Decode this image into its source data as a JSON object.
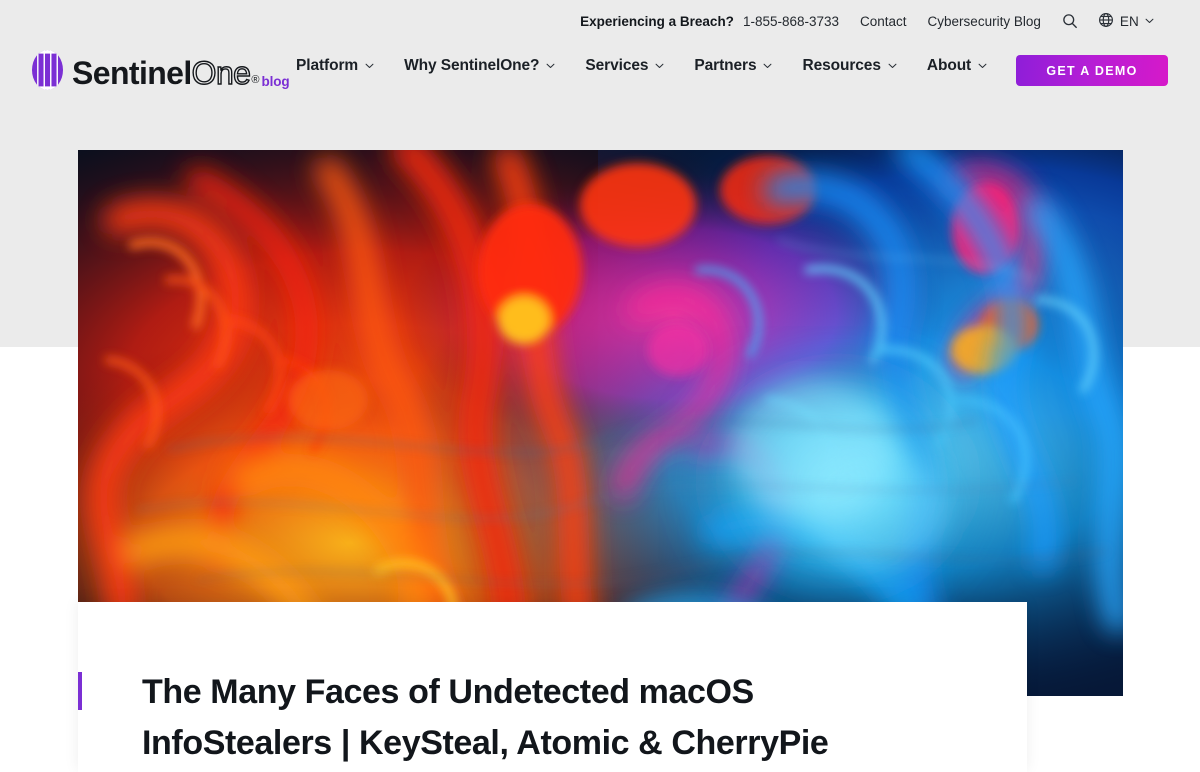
{
  "site": {
    "logo": {
      "mark": "sentinelone-logo-mark",
      "word_bold": "Sentinel",
      "word_outline": "One",
      "registered": "®",
      "sub_brand": "blog"
    },
    "brand_purple": "#7b2fd4",
    "header_background": "#ebebeb"
  },
  "utility_bar": {
    "breach_label": "Experiencing a Breach?",
    "breach_phone": "1-855-868-3733",
    "links": [
      {
        "label": "Contact"
      },
      {
        "label": "Cybersecurity Blog"
      }
    ],
    "search_icon": "search-icon",
    "globe_icon": "globe-icon",
    "language": "EN",
    "language_chevron": "chevron-down-icon"
  },
  "nav": {
    "items": [
      {
        "label": "Platform",
        "has_dropdown": true
      },
      {
        "label": "Why SentinelOne?",
        "has_dropdown": true
      },
      {
        "label": "Services",
        "has_dropdown": true
      },
      {
        "label": "Partners",
        "has_dropdown": true
      },
      {
        "label": "Resources",
        "has_dropdown": true
      },
      {
        "label": "About",
        "has_dropdown": true
      }
    ],
    "cta": {
      "label": "GET A DEMO",
      "gradient_from": "#8e1ed8",
      "gradient_to": "#d619c9"
    }
  },
  "hero": {
    "alt": "Abstract red, orange, magenta and blue ink swirling in dark water",
    "palette": {
      "background": "#081020",
      "red": "#f02a15",
      "orange": "#ff7a10",
      "yellow": "#ffd23a",
      "magenta": "#ff1d86",
      "cyan": "#22c8ff",
      "blue": "#0a5ef0",
      "pale_cyan": "#7fe4ff"
    }
  },
  "article": {
    "accent_color": "#7b2fd4",
    "title": "The Many Faces of Undetected macOS InfoStealers | KeySteal, Atomic & CherryPie"
  }
}
